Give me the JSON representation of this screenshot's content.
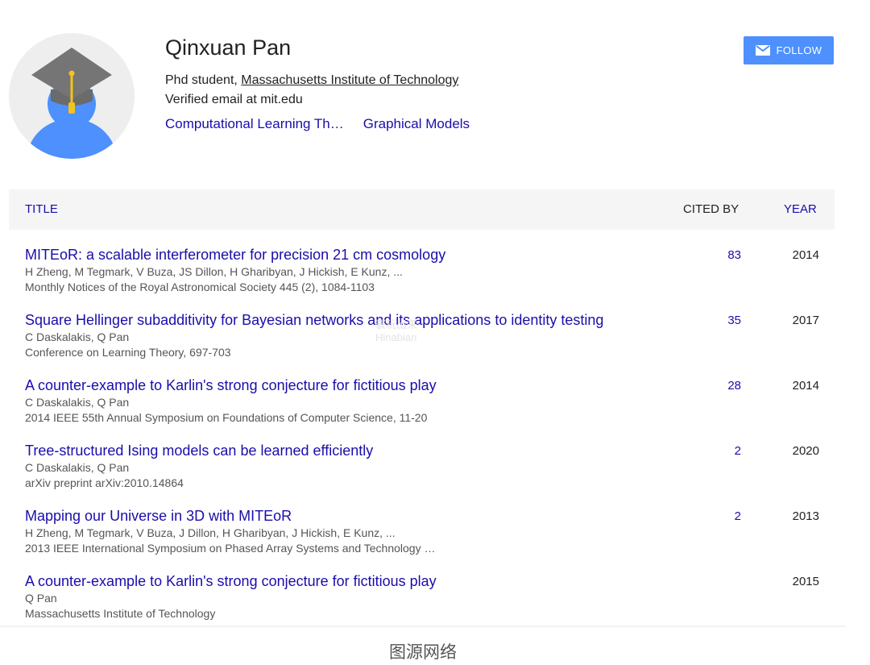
{
  "profile": {
    "name": "Qinxuan Pan",
    "affiliation_prefix": "Phd student, ",
    "affiliation_link": "Massachusetts Institute of Technology",
    "email_verification": "Verified email at mit.edu",
    "interests": [
      "Computational Learning Th…",
      "Graphical Models"
    ],
    "avatar_icon": "graduation-cap-avatar-icon"
  },
  "follow_button": {
    "label": "FOLLOW",
    "icon": "mail-icon",
    "color": "#4d90fe"
  },
  "table": {
    "headers": {
      "title": "TITLE",
      "cited_by": "CITED BY",
      "year": "YEAR"
    },
    "articles": [
      {
        "title": "MITEoR: a scalable interferometer for precision 21 cm cosmology",
        "authors": "H Zheng, M Tegmark, V Buza, JS Dillon, H Gharibyan, J Hickish, E Kunz, ...",
        "venue": "Monthly Notices of the Royal Astronomical Society 445 (2), 1084-1103",
        "cited_by": "83",
        "year": "2014"
      },
      {
        "title": "Square Hellinger subadditivity for Bayesian networks and its applications to identity testing",
        "authors": "C Daskalakis, Q Pan",
        "venue": "Conference on Learning Theory, 697-703",
        "cited_by": "35",
        "year": "2017"
      },
      {
        "title": "A counter-example to Karlin's strong conjecture for fictitious play",
        "authors": "C Daskalakis, Q Pan",
        "venue": "2014 IEEE 55th Annual Symposium on Foundations of Computer Science, 11-20",
        "cited_by": "28",
        "year": "2014"
      },
      {
        "title": "Tree-structured Ising models can be learned efficiently",
        "authors": "C Daskalakis, Q Pan",
        "venue": "arXiv preprint arXiv:2010.14864",
        "cited_by": "2",
        "year": "2020"
      },
      {
        "title": "Mapping our Universe in 3D with MITEoR",
        "authors": "H Zheng, M Tegmark, V Buza, J Dillon, H Gharibyan, J Hickish, E Kunz, ...",
        "venue": "2013 IEEE International Symposium on Phased Array Systems and Technology …",
        "cited_by": "2",
        "year": "2013"
      },
      {
        "title": "A counter-example to Karlin's strong conjecture for fictitious play",
        "authors": "Q Pan",
        "venue": "Massachusetts Institute of Technology",
        "cited_by": "",
        "year": "2015"
      }
    ]
  },
  "watermark": {
    "line1": "寰玩出来",
    "line2": "Hinabian"
  },
  "caption": "图源网络",
  "colors": {
    "link": "#1a0dab",
    "accent": "#4d90fe",
    "header_bg": "#f5f5f5"
  }
}
